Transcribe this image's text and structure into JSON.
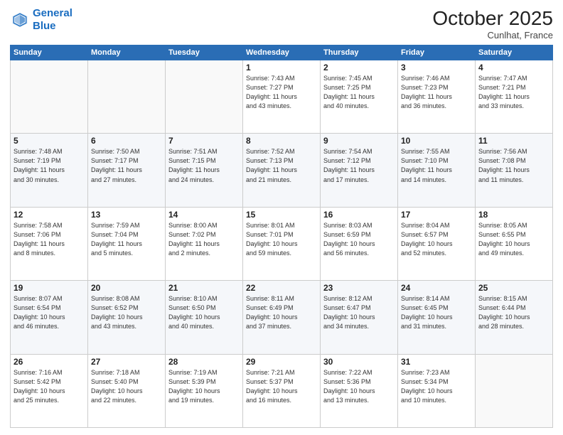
{
  "header": {
    "logo_line1": "General",
    "logo_line2": "Blue",
    "month": "October 2025",
    "location": "Cunlhat, France"
  },
  "weekdays": [
    "Sunday",
    "Monday",
    "Tuesday",
    "Wednesday",
    "Thursday",
    "Friday",
    "Saturday"
  ],
  "weeks": [
    [
      {
        "day": "",
        "info": ""
      },
      {
        "day": "",
        "info": ""
      },
      {
        "day": "",
        "info": ""
      },
      {
        "day": "1",
        "info": "Sunrise: 7:43 AM\nSunset: 7:27 PM\nDaylight: 11 hours\nand 43 minutes."
      },
      {
        "day": "2",
        "info": "Sunrise: 7:45 AM\nSunset: 7:25 PM\nDaylight: 11 hours\nand 40 minutes."
      },
      {
        "day": "3",
        "info": "Sunrise: 7:46 AM\nSunset: 7:23 PM\nDaylight: 11 hours\nand 36 minutes."
      },
      {
        "day": "4",
        "info": "Sunrise: 7:47 AM\nSunset: 7:21 PM\nDaylight: 11 hours\nand 33 minutes."
      }
    ],
    [
      {
        "day": "5",
        "info": "Sunrise: 7:48 AM\nSunset: 7:19 PM\nDaylight: 11 hours\nand 30 minutes."
      },
      {
        "day": "6",
        "info": "Sunrise: 7:50 AM\nSunset: 7:17 PM\nDaylight: 11 hours\nand 27 minutes."
      },
      {
        "day": "7",
        "info": "Sunrise: 7:51 AM\nSunset: 7:15 PM\nDaylight: 11 hours\nand 24 minutes."
      },
      {
        "day": "8",
        "info": "Sunrise: 7:52 AM\nSunset: 7:13 PM\nDaylight: 11 hours\nand 21 minutes."
      },
      {
        "day": "9",
        "info": "Sunrise: 7:54 AM\nSunset: 7:12 PM\nDaylight: 11 hours\nand 17 minutes."
      },
      {
        "day": "10",
        "info": "Sunrise: 7:55 AM\nSunset: 7:10 PM\nDaylight: 11 hours\nand 14 minutes."
      },
      {
        "day": "11",
        "info": "Sunrise: 7:56 AM\nSunset: 7:08 PM\nDaylight: 11 hours\nand 11 minutes."
      }
    ],
    [
      {
        "day": "12",
        "info": "Sunrise: 7:58 AM\nSunset: 7:06 PM\nDaylight: 11 hours\nand 8 minutes."
      },
      {
        "day": "13",
        "info": "Sunrise: 7:59 AM\nSunset: 7:04 PM\nDaylight: 11 hours\nand 5 minutes."
      },
      {
        "day": "14",
        "info": "Sunrise: 8:00 AM\nSunset: 7:02 PM\nDaylight: 11 hours\nand 2 minutes."
      },
      {
        "day": "15",
        "info": "Sunrise: 8:01 AM\nSunset: 7:01 PM\nDaylight: 10 hours\nand 59 minutes."
      },
      {
        "day": "16",
        "info": "Sunrise: 8:03 AM\nSunset: 6:59 PM\nDaylight: 10 hours\nand 56 minutes."
      },
      {
        "day": "17",
        "info": "Sunrise: 8:04 AM\nSunset: 6:57 PM\nDaylight: 10 hours\nand 52 minutes."
      },
      {
        "day": "18",
        "info": "Sunrise: 8:05 AM\nSunset: 6:55 PM\nDaylight: 10 hours\nand 49 minutes."
      }
    ],
    [
      {
        "day": "19",
        "info": "Sunrise: 8:07 AM\nSunset: 6:54 PM\nDaylight: 10 hours\nand 46 minutes."
      },
      {
        "day": "20",
        "info": "Sunrise: 8:08 AM\nSunset: 6:52 PM\nDaylight: 10 hours\nand 43 minutes."
      },
      {
        "day": "21",
        "info": "Sunrise: 8:10 AM\nSunset: 6:50 PM\nDaylight: 10 hours\nand 40 minutes."
      },
      {
        "day": "22",
        "info": "Sunrise: 8:11 AM\nSunset: 6:49 PM\nDaylight: 10 hours\nand 37 minutes."
      },
      {
        "day": "23",
        "info": "Sunrise: 8:12 AM\nSunset: 6:47 PM\nDaylight: 10 hours\nand 34 minutes."
      },
      {
        "day": "24",
        "info": "Sunrise: 8:14 AM\nSunset: 6:45 PM\nDaylight: 10 hours\nand 31 minutes."
      },
      {
        "day": "25",
        "info": "Sunrise: 8:15 AM\nSunset: 6:44 PM\nDaylight: 10 hours\nand 28 minutes."
      }
    ],
    [
      {
        "day": "26",
        "info": "Sunrise: 7:16 AM\nSunset: 5:42 PM\nDaylight: 10 hours\nand 25 minutes."
      },
      {
        "day": "27",
        "info": "Sunrise: 7:18 AM\nSunset: 5:40 PM\nDaylight: 10 hours\nand 22 minutes."
      },
      {
        "day": "28",
        "info": "Sunrise: 7:19 AM\nSunset: 5:39 PM\nDaylight: 10 hours\nand 19 minutes."
      },
      {
        "day": "29",
        "info": "Sunrise: 7:21 AM\nSunset: 5:37 PM\nDaylight: 10 hours\nand 16 minutes."
      },
      {
        "day": "30",
        "info": "Sunrise: 7:22 AM\nSunset: 5:36 PM\nDaylight: 10 hours\nand 13 minutes."
      },
      {
        "day": "31",
        "info": "Sunrise: 7:23 AM\nSunset: 5:34 PM\nDaylight: 10 hours\nand 10 minutes."
      },
      {
        "day": "",
        "info": ""
      }
    ]
  ]
}
